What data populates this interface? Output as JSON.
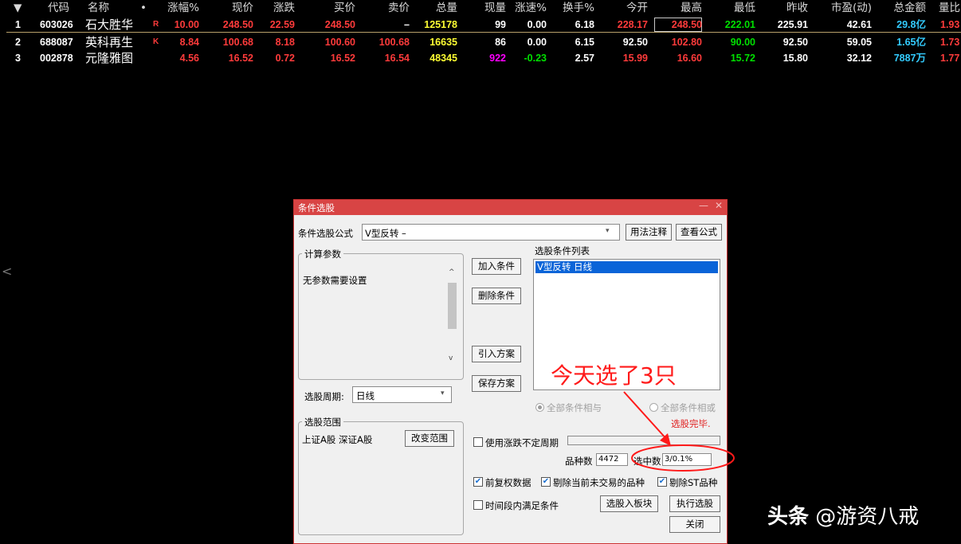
{
  "table": {
    "columns": {
      "menu": "▼",
      "code": "代码",
      "name": "名称",
      "dot": "•",
      "change_pct": "涨幅%",
      "price": "现价",
      "change": "涨跌",
      "bid": "买价",
      "ask": "卖价",
      "volume": "总量",
      "cur_vol": "现量",
      "speed": "涨速%",
      "turnover": "换手%",
      "open": "今开",
      "high": "最高",
      "low": "最低",
      "prev_close": "昨收",
      "pe": "市盈(动)",
      "amount": "总金额",
      "vol_ratio": "量比"
    },
    "rows": [
      {
        "idx": "1",
        "code": "603026",
        "name": "石大胜华",
        "flag": "R",
        "change_pct": "10.00",
        "price": "248.50",
        "change": "22.59",
        "bid": "248.50",
        "ask": "–",
        "volume": "125178",
        "cur_vol": "99",
        "speed": "0.00",
        "turnover": "6.18",
        "open": "228.17",
        "high": "248.50",
        "low": "222.01",
        "prev_close": "225.91",
        "pe": "42.61",
        "amount": "29.8亿",
        "vol_ratio": "1.93"
      },
      {
        "idx": "2",
        "code": "688087",
        "name": "英科再生",
        "flag": "K",
        "change_pct": "8.84",
        "price": "100.68",
        "change": "8.18",
        "bid": "100.60",
        "ask": "100.68",
        "volume": "16635",
        "cur_vol": "86",
        "speed": "0.00",
        "turnover": "6.15",
        "open": "92.50",
        "high": "102.80",
        "low": "90.00",
        "prev_close": "92.50",
        "pe": "59.05",
        "amount": "1.65亿",
        "vol_ratio": "1.73"
      },
      {
        "idx": "3",
        "code": "002878",
        "name": "元隆雅图",
        "flag": "",
        "change_pct": "4.56",
        "price": "16.52",
        "change": "0.72",
        "bid": "16.52",
        "ask": "16.54",
        "volume": "48345",
        "cur_vol": "922",
        "speed": "-0.23",
        "turnover": "2.57",
        "open": "15.99",
        "high": "16.60",
        "low": "15.72",
        "prev_close": "15.80",
        "pe": "32.12",
        "amount": "7887万",
        "vol_ratio": "1.77"
      }
    ],
    "side_arrow": "<"
  },
  "dialog": {
    "title": "条件选股",
    "min_glyph": "—",
    "close_glyph": "✕",
    "formula_label": "条件选股公式",
    "formula_value": "V型反转       –",
    "usage_btn": "用法注释",
    "view_btn": "查看公式",
    "params_legend": "计算参数",
    "no_params": "无参数需要设置",
    "add_btn": "加入条件",
    "del_btn": "删除条件",
    "import_btn": "引入方案",
    "save_btn": "保存方案",
    "cond_list_label": "选股条件列表",
    "cond_items": [
      "V型反转   日线"
    ],
    "radio_and": "全部条件相与",
    "radio_or": "全部条件相或",
    "period_label": "选股周期:",
    "period_value": "日线",
    "range_legend": "选股范围",
    "range_value": "上证A股  深证A股",
    "change_range_btn": "改变范围",
    "done_text": "选股完毕.",
    "use_period_label": "使用涨跌不定周期",
    "count_label": "品种数",
    "count_value": "4472",
    "selected_label": "选中数",
    "selected_value": "3/0.1%",
    "adj_label": "前复权数据",
    "exclude_untraded_label": "剔除当前未交易的品种",
    "exclude_st_label": "剔除ST品种",
    "period_satisfy_label": "时间段内满足条件",
    "to_block_btn": "选股入板块",
    "run_btn": "执行选股",
    "close_btn": "关闭"
  },
  "annotation": "今天选了3只",
  "watermark": {
    "brand": "头条",
    "handle": "@游资八戒"
  },
  "colors": {
    "up": "#ff3b3b",
    "down": "#00e000",
    "volume": "#ffff33",
    "amount": "#33ccff",
    "dialog_title": "#d84444",
    "annotation": "#ff1a1a"
  }
}
